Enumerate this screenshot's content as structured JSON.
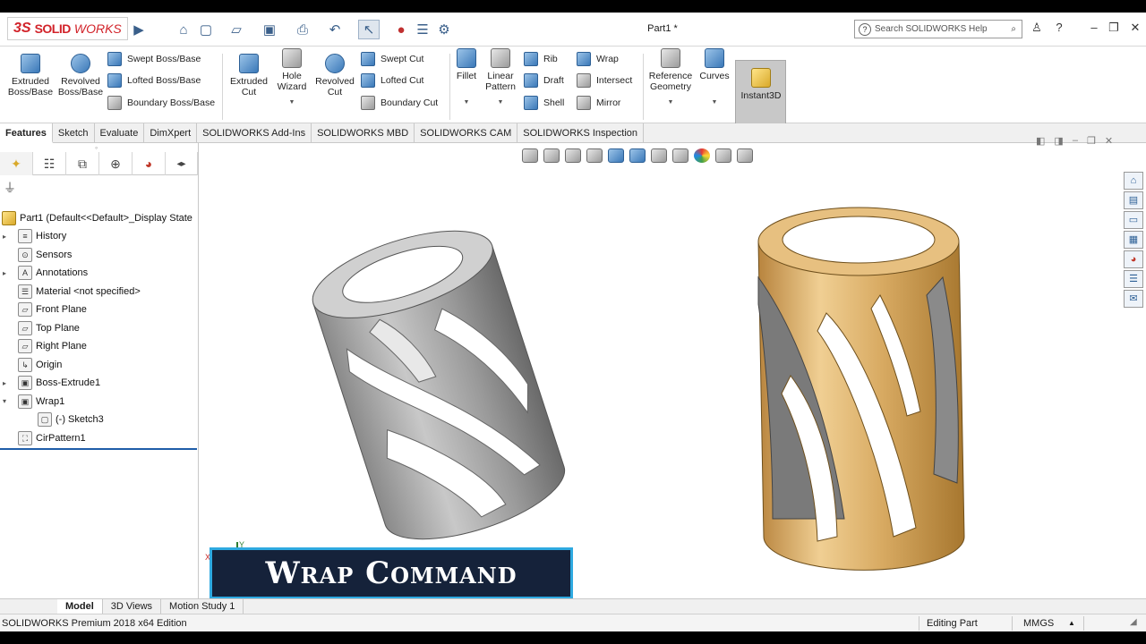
{
  "app": {
    "brand_ds": "3S",
    "brand_solid": "SOLID",
    "brand_works": "WORKS",
    "document_title": "Part1 *",
    "search_placeholder": "Search SOLIDWORKS Help"
  },
  "ribbon": {
    "extruded_boss": "Extruded Boss/Base",
    "revolved_boss": "Revolved Boss/Base",
    "swept_boss": "Swept Boss/Base",
    "lofted_boss": "Lofted Boss/Base",
    "boundary_boss": "Boundary Boss/Base",
    "extruded_cut": "Extruded Cut",
    "hole_wizard": "Hole Wizard",
    "revolved_cut": "Revolved Cut",
    "swept_cut": "Swept Cut",
    "lofted_cut": "Lofted Cut",
    "boundary_cut": "Boundary Cut",
    "fillet": "Fillet",
    "linear_pattern": "Linear Pattern",
    "rib": "Rib",
    "draft": "Draft",
    "shell": "Shell",
    "wrap": "Wrap",
    "intersect": "Intersect",
    "mirror": "Mirror",
    "reference_geometry": "Reference Geometry",
    "curves": "Curves",
    "instant3d": "Instant3D"
  },
  "tabs": [
    "Features",
    "Sketch",
    "Evaluate",
    "DimXpert",
    "SOLIDWORKS Add-Ins",
    "SOLIDWORKS MBD",
    "SOLIDWORKS CAM",
    "SOLIDWORKS Inspection"
  ],
  "tree": {
    "root": "Part1  (Default<<Default>_Display State",
    "items": [
      {
        "label": "History",
        "expandable": true
      },
      {
        "label": "Sensors",
        "expandable": false
      },
      {
        "label": "Annotations",
        "expandable": true
      },
      {
        "label": "Material <not specified>",
        "expandable": false
      },
      {
        "label": "Front Plane",
        "expandable": false
      },
      {
        "label": "Top Plane",
        "expandable": false
      },
      {
        "label": "Right Plane",
        "expandable": false
      },
      {
        "label": "Origin",
        "expandable": false
      },
      {
        "label": "Boss-Extrude1",
        "expandable": true
      },
      {
        "label": "Wrap1",
        "expandable": true
      },
      {
        "label": "(-) Sketch3",
        "expandable": false
      },
      {
        "label": "CirPattern1",
        "expandable": false
      }
    ]
  },
  "banner": {
    "text": "Wrap Command"
  },
  "bottom_tabs": [
    "Model",
    "3D Views",
    "Motion Study 1"
  ],
  "status": {
    "edition": "SOLIDWORKS Premium 2018 x64 Edition",
    "mode": "Editing Part",
    "units": "MMGS"
  },
  "colors": {
    "accent": "#d2232a",
    "selection": "#1f5da8",
    "banner_bg": "#15223a",
    "banner_border": "#2ea9e0",
    "gold": "#d8aa62",
    "steel": "#9a9a9a"
  }
}
